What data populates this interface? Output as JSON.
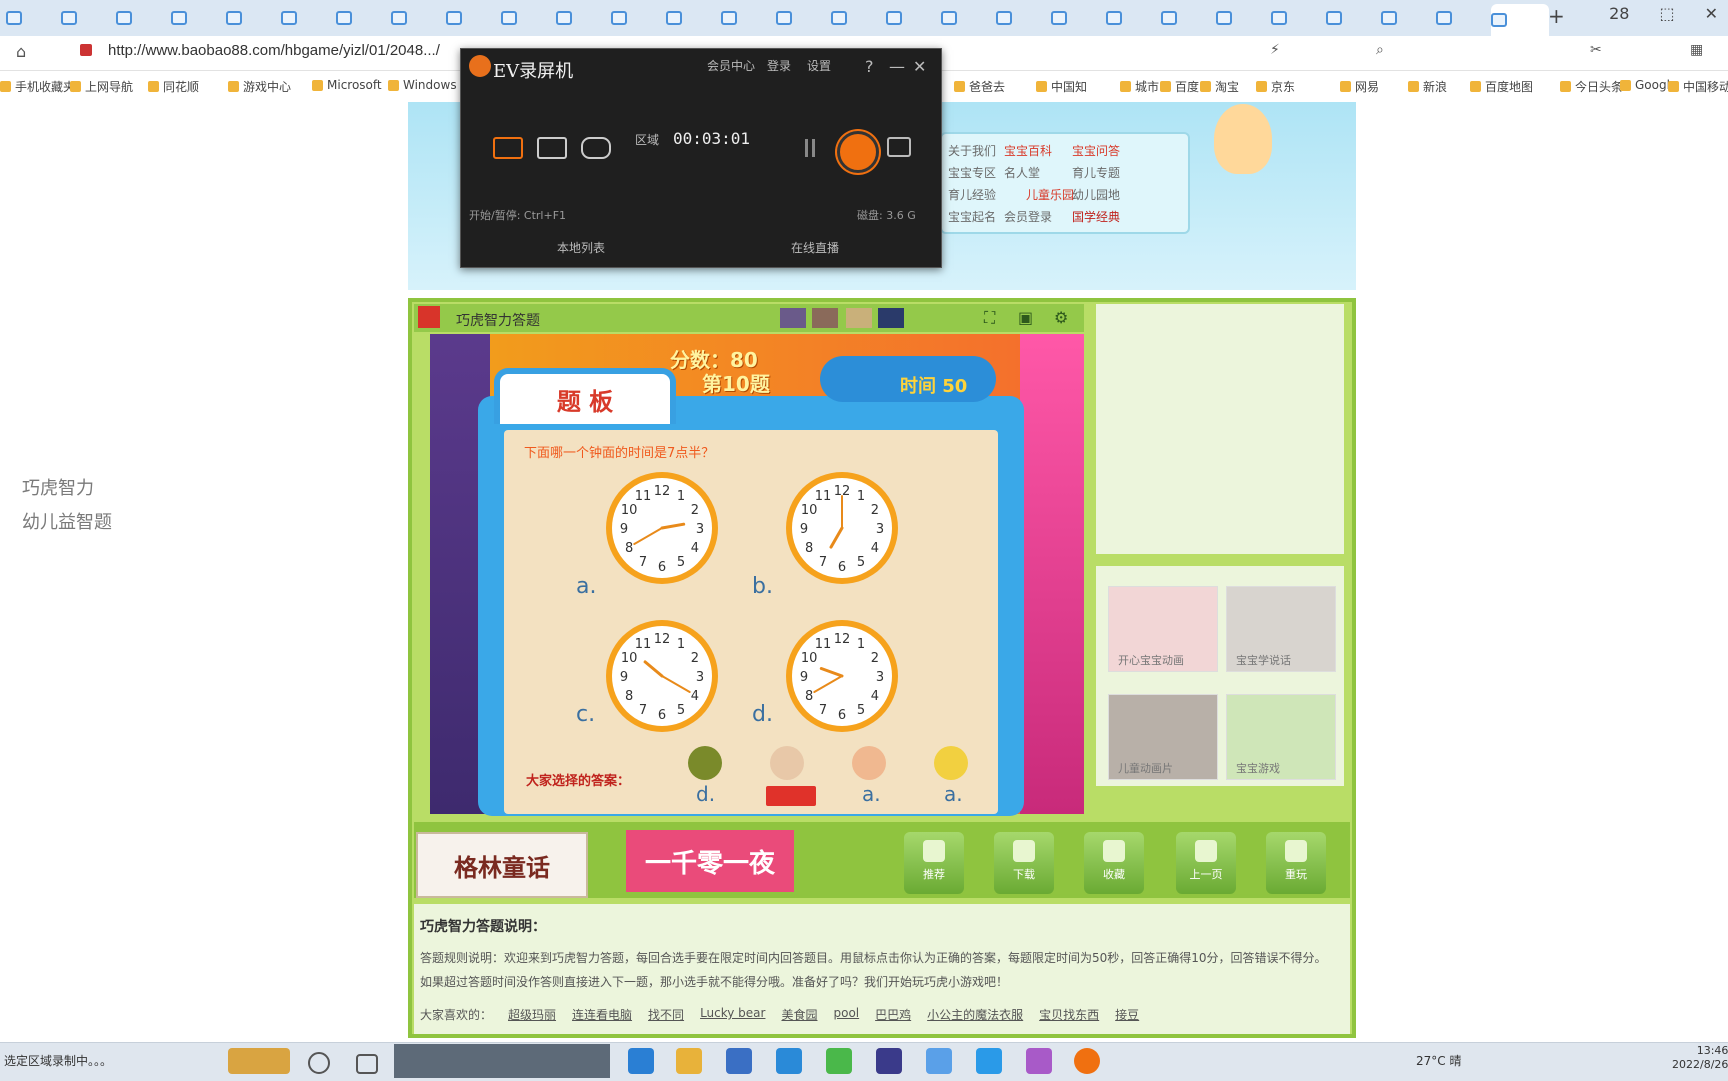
{
  "browser": {
    "tabs_count": 28,
    "new_tab": "+",
    "window_controls": [
      "28",
      "⬚",
      "✕"
    ],
    "url": "http://www.baobao88.com/hbgame/yizl/01/2048.../",
    "bookmarks": [
      "手机收藏夹",
      "上网导航",
      "同花顺",
      "游戏中心",
      "Microsoft",
      "Windows",
      "爸爸去",
      "中国知",
      "城市",
      "百度",
      "淘宝",
      "京东",
      "网易",
      "新浪",
      "百度地图",
      "今日头条",
      "Google",
      "中国移动"
    ]
  },
  "recorder": {
    "title": "EV录屏机",
    "menu": [
      "会员中心",
      "登录",
      "设置",
      "?",
      "—",
      "✕"
    ],
    "mode_label": "区域",
    "time": "00:03:01",
    "shortcut_text": "开始/暂停: Ctrl+F1",
    "disk_text": "磁盘: 3.6 G",
    "footer_left": "本地列表",
    "footer_right": "在线直播"
  },
  "site": {
    "nav_links": [
      "关于我们",
      "宝宝百科",
      "宝宝问答",
      "宝宝专区",
      "名人堂",
      "育儿专题",
      "育儿经验",
      "儿童乐园",
      "幼儿园地",
      "宝宝起名",
      "会员登录",
      "国学经典"
    ]
  },
  "game": {
    "title": "巧虎智力答题",
    "score_label": "分数：80",
    "question_label": "第10题",
    "timer_label": "时间 50",
    "board_tab": "题 板",
    "question_text": "下面哪一个钟面的时间是7点半？",
    "options": [
      {
        "label": "a.",
        "hour": 2,
        "minute": 40
      },
      {
        "label": "b.",
        "hour": 7,
        "minute": 0
      },
      {
        "label": "c.",
        "hour": 10,
        "minute": 20
      },
      {
        "label": "d.",
        "hour": 9,
        "minute": 40
      }
    ],
    "answer_prompt": "大家选择的答案：",
    "player_answers": [
      "d.",
      "",
      "a.",
      "a."
    ]
  },
  "side": {
    "thumbs": [
      "开心宝宝动画",
      "宝宝学说话",
      "儿童动画片",
      "宝宝游戏"
    ]
  },
  "toolbar": {
    "logo_left": "格林童话",
    "logo_right": "一千零一夜",
    "buttons": [
      "推荐",
      "下载",
      "收藏",
      "上一页",
      "重玩"
    ]
  },
  "instructions": {
    "title": "巧虎智力答题说明：",
    "text": "答题规则说明：欢迎来到巧虎智力答题，每回合选手要在限定时间内回答题目。用鼠标点击你认为正确的答案，每题限定时间为50秒，回答正确得10分，回答错误不得分。如果超过答题时间没作答则直接进入下一题，那小选手就不能得分哦。准备好了吗？我们开始玩巧虎小游戏吧！",
    "related_label": "大家喜欢的：",
    "related": [
      "超级玛丽",
      "连连看电脑",
      "找不同",
      "Lucky bear",
      "美食园",
      "pool",
      "巴巴鸡",
      "小公主的魔法衣服",
      "宝贝找东西",
      "接豆"
    ]
  },
  "overlay": {
    "line1": "巧虎智力",
    "line2": "幼儿益智题"
  },
  "taskbar": {
    "status": "选定区域录制中。。。",
    "weather": "27°C 晴",
    "time": "13:46",
    "date": "2022/8/26"
  }
}
